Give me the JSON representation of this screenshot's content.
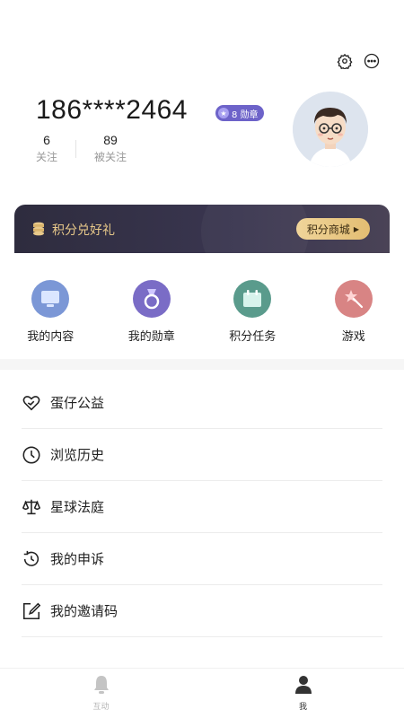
{
  "header": {
    "settings_icon": "gear-icon",
    "more_icon": "more-icon"
  },
  "profile": {
    "phone": "186****2464",
    "badge_text": "8 勋章",
    "stats": [
      {
        "value": "6",
        "label": "关注"
      },
      {
        "value": "89",
        "label": "被关注"
      }
    ]
  },
  "banner": {
    "title": "积分兑好礼",
    "button": "积分商城"
  },
  "quick": [
    {
      "label": "我的内容",
      "color": "#7b97d6",
      "icon": "monitor-icon"
    },
    {
      "label": "我的勋章",
      "color": "#7a6cc6",
      "icon": "medal-icon"
    },
    {
      "label": "积分任务",
      "color": "#5a9b8c",
      "icon": "calendar-icon"
    },
    {
      "label": "游戏",
      "color": "#d88484",
      "icon": "magic-wand-icon"
    }
  ],
  "menu": [
    {
      "label": "蛋仔公益",
      "icon": "heart-hand-icon"
    },
    {
      "label": "浏览历史",
      "icon": "clock-icon"
    },
    {
      "label": "星球法庭",
      "icon": "scale-icon"
    },
    {
      "label": "我的申诉",
      "icon": "history-icon"
    },
    {
      "label": "我的邀请码",
      "icon": "edit-icon"
    }
  ],
  "tabs": [
    {
      "label": "互动",
      "icon": "bell-icon",
      "active": false,
      "color": "#b5b5b5"
    },
    {
      "label": "我",
      "icon": "person-icon",
      "active": true,
      "color": "#333333"
    }
  ]
}
